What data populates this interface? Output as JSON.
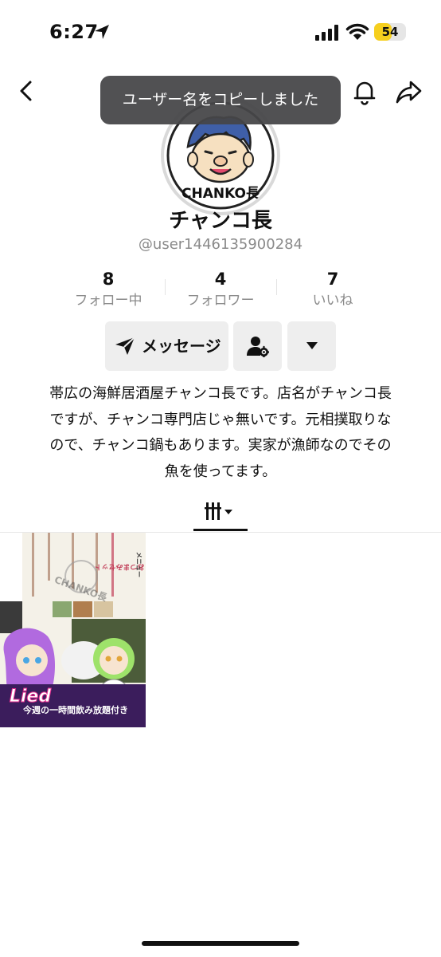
{
  "status_bar": {
    "time": "6:27",
    "battery_level": "54",
    "battery_color": "#f6cf1e",
    "icons": [
      "location-arrow-icon",
      "cellular-signal-icon",
      "wifi-icon",
      "battery-icon"
    ]
  },
  "nav": {
    "icons": [
      "back-chevron-icon",
      "bell-icon",
      "share-icon"
    ]
  },
  "toast": {
    "text": "ユーザー名をコピーしました"
  },
  "profile": {
    "avatar_logo_text": "CHANKO長",
    "display_name": "チャンコ長",
    "username": "@user1446135900284"
  },
  "stats": [
    {
      "value": "8",
      "label": "フォロー中"
    },
    {
      "value": "4",
      "label": "フォロワー"
    },
    {
      "value": "7",
      "label": "いいね"
    }
  ],
  "actions": {
    "message_label": "メッセージ",
    "icons": [
      "send-icon",
      "user-settings-icon",
      "caret-down-icon"
    ]
  },
  "bio": {
    "lines": [
      "帯広の海鮮居酒屋チャンコ長です。店名がチャンコ長",
      "ですが、チャンコ専門店じゃ無いです。元相撲取りな",
      "ので、チャンコ鍋もあります。実家が漁師なのでその",
      "魚を使ってます。"
    ]
  },
  "tabs": {
    "active_icon": "video-grid-icon"
  },
  "videos": [
    {
      "id_hint": "video-1",
      "overlay_texts": [
        "Lied",
        "今週の一時間飲み放題付き",
        "おつまみセット",
        "メニュー",
        "CHANKO長"
      ]
    }
  ],
  "colors": {
    "accent": "#111111",
    "secondary_text": "#8a8a8a",
    "button_bg": "#eeeeee",
    "toast_bg": "#464648"
  }
}
